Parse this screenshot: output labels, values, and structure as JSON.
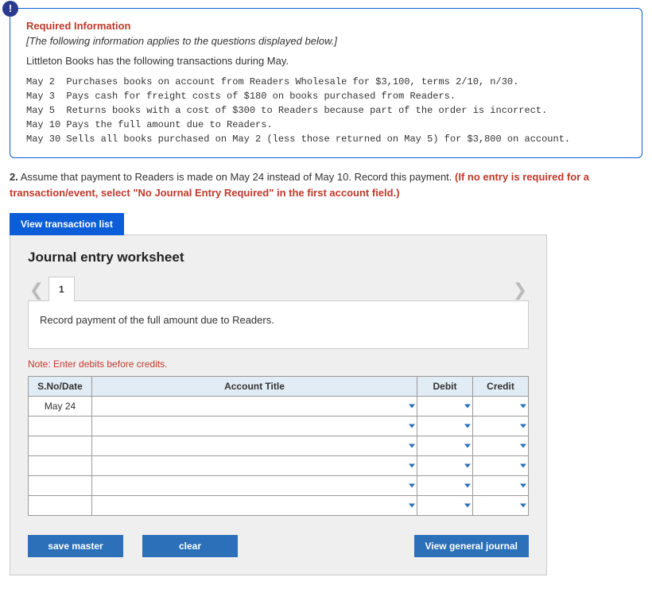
{
  "info": {
    "badge_glyph": "!",
    "title": "Required Information",
    "subtitle": "[The following information applies to the questions displayed below.]",
    "lead": "Littleton Books has the following transactions during May.",
    "transactions": "May 2  Purchases books on account from Readers Wholesale for $3,100, terms 2/10, n/30.\nMay 3  Pays cash for freight costs of $180 on books purchased from Readers.\nMay 5  Returns books with a cost of $300 to Readers because part of the order is incorrect.\nMay 10 Pays the full amount due to Readers.\nMay 30 Sells all books purchased on May 2 (less those returned on May 5) for $3,800 on account."
  },
  "question": {
    "num": "2.",
    "body": " Assume that payment to Readers is made on May 24 instead of May 10. Record this payment. ",
    "red": "(If no entry is required for a transaction/event, select \"No Journal Entry Required\" in the first account field.)"
  },
  "buttons": {
    "view_list": "View transaction list",
    "save": "save master",
    "clear": "clear",
    "view_journal": "View general journal"
  },
  "worksheet": {
    "title": "Journal entry worksheet",
    "tab_label": "1",
    "instruction": "Record payment of the full amount due to Readers.",
    "note": "Note: Enter debits before credits.",
    "headers": {
      "date": "S.No/Date",
      "acct": "Account Title",
      "debit": "Debit",
      "credit": "Credit"
    },
    "date_value": "May 24"
  }
}
